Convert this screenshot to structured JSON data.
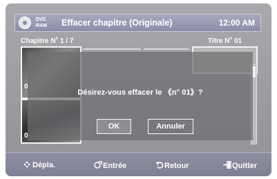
{
  "header": {
    "disc_label_line1": "DVD",
    "disc_label_line2": "-RAM",
    "title": "Effacer chapitre (Originale)",
    "time": "12:00 AM"
  },
  "chapter_info": {
    "prefix": "Chapitre N",
    "sup": "o",
    "value": " 1 / 7"
  },
  "title_info": {
    "prefix": "Titre N",
    "sup": "o",
    "value": " 01"
  },
  "thumbnails": {
    "label_1": "0",
    "label_2": "0"
  },
  "dialog": {
    "message": "Désirez-vous effacer le 《n° 01》?",
    "ok_label": "OK",
    "cancel_label": "Annuler"
  },
  "footer": {
    "move_icon": "move-arrows-icon",
    "move_label": "Dépla.",
    "enter_icon": "enter-icon",
    "enter_label": "Entrée",
    "return_icon": "return-arrow-icon",
    "return_label": "Retour",
    "exit_icon": "exit-door-icon",
    "exit_label": "Quitter"
  },
  "colors": {
    "background": "#9c9ca0",
    "header_bar": "#8c8ea8",
    "footer_bar": "#85859a",
    "text": "#ffffff"
  }
}
